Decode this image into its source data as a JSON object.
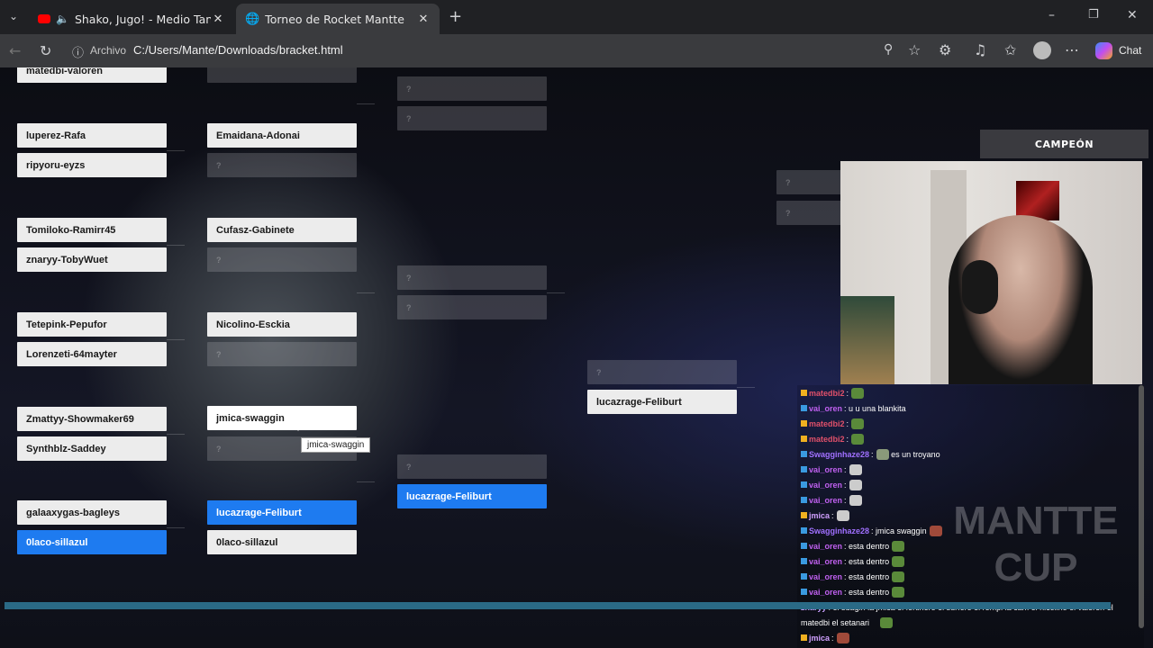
{
  "tabs": [
    {
      "title": "Shako, Jugo! - Medio Tana (Vi",
      "icon": "youtube-icon",
      "audio": "speaker-icon"
    },
    {
      "title": "Torneo de Rocket Mantte",
      "icon": "globe-icon"
    }
  ],
  "address": {
    "label": "Archivo",
    "url": "C:/Users/Mante/Downloads/bracket.html"
  },
  "toolbar": {
    "chat_label": "Chat"
  },
  "bracket": {
    "round1": [
      "matedbi-valoren",
      "luperez-Rafa",
      "ripyoru-eyzs",
      "Tomiloko-Ramirr45",
      "znaryy-TobyWuet",
      "Tetepink-Pepufor",
      "Lorenzeti-64mayter",
      "Zmattyy-Showmaker69",
      "Synthblz-Saddey",
      "galaaxygas-bagleys",
      "0laco-sillazul"
    ],
    "round2": [
      "Emaidana-Adonai",
      "Cufasz-Gabinete",
      "Nicolino-Esckia",
      "jmica-swaggin",
      "lucazrage-Feliburt",
      "0laco-sillazul"
    ],
    "round3": [
      "lucazrage-Feliburt"
    ],
    "round4": [
      "lucazrage-Feliburt"
    ],
    "empty_marker": "?",
    "champion_label": "CAMPEÓN"
  },
  "tooltip": "jmica-swaggin",
  "watermark": [
    "MANTTE",
    "CUP"
  ],
  "chat": [
    {
      "user": "matedbi2",
      "color": "#e0506a",
      "text": ""
    },
    {
      "user": "vai_oren",
      "color": "#c060f0",
      "text": "u u una blankita"
    },
    {
      "user": "matedbi2",
      "color": "#e0506a",
      "text": ""
    },
    {
      "user": "matedbi2",
      "color": "#e0506a",
      "text": ""
    },
    {
      "user": "Swagginhaze28",
      "color": "#a070ff",
      "text": "es un troyano"
    },
    {
      "user": "vai_oren",
      "color": "#c060f0",
      "text": ""
    },
    {
      "user": "vai_oren",
      "color": "#c060f0",
      "text": ""
    },
    {
      "user": "vai_oren",
      "color": "#c060f0",
      "text": ""
    },
    {
      "user": "jmica",
      "color": "#d0a0ff",
      "text": ""
    },
    {
      "user": "Swagginhaze28",
      "color": "#a070ff",
      "text": "jmica swaggin"
    },
    {
      "user": "vai_oren",
      "color": "#c060f0",
      "text": "esta dentro"
    },
    {
      "user": "vai_oren",
      "color": "#c060f0",
      "text": "esta dentro"
    },
    {
      "user": "vai_oren",
      "color": "#c060f0",
      "text": "esta dentro"
    },
    {
      "user": "vai_oren",
      "color": "#c060f0",
      "text": "esta dentro"
    },
    {
      "user": "znaryy",
      "color": "#c8a0ff",
      "text": "el suagin la jmica el fortinero el surfero el rompi la cam el nicolino el valoren el"
    },
    {
      "user": "",
      "color": "#ffffff",
      "text": "matedbi el setanari"
    },
    {
      "user": "jmica",
      "color": "#d0a0ff",
      "text": ""
    }
  ],
  "colors": {
    "accent": "#1e7bf0",
    "chrome": "#202124"
  }
}
